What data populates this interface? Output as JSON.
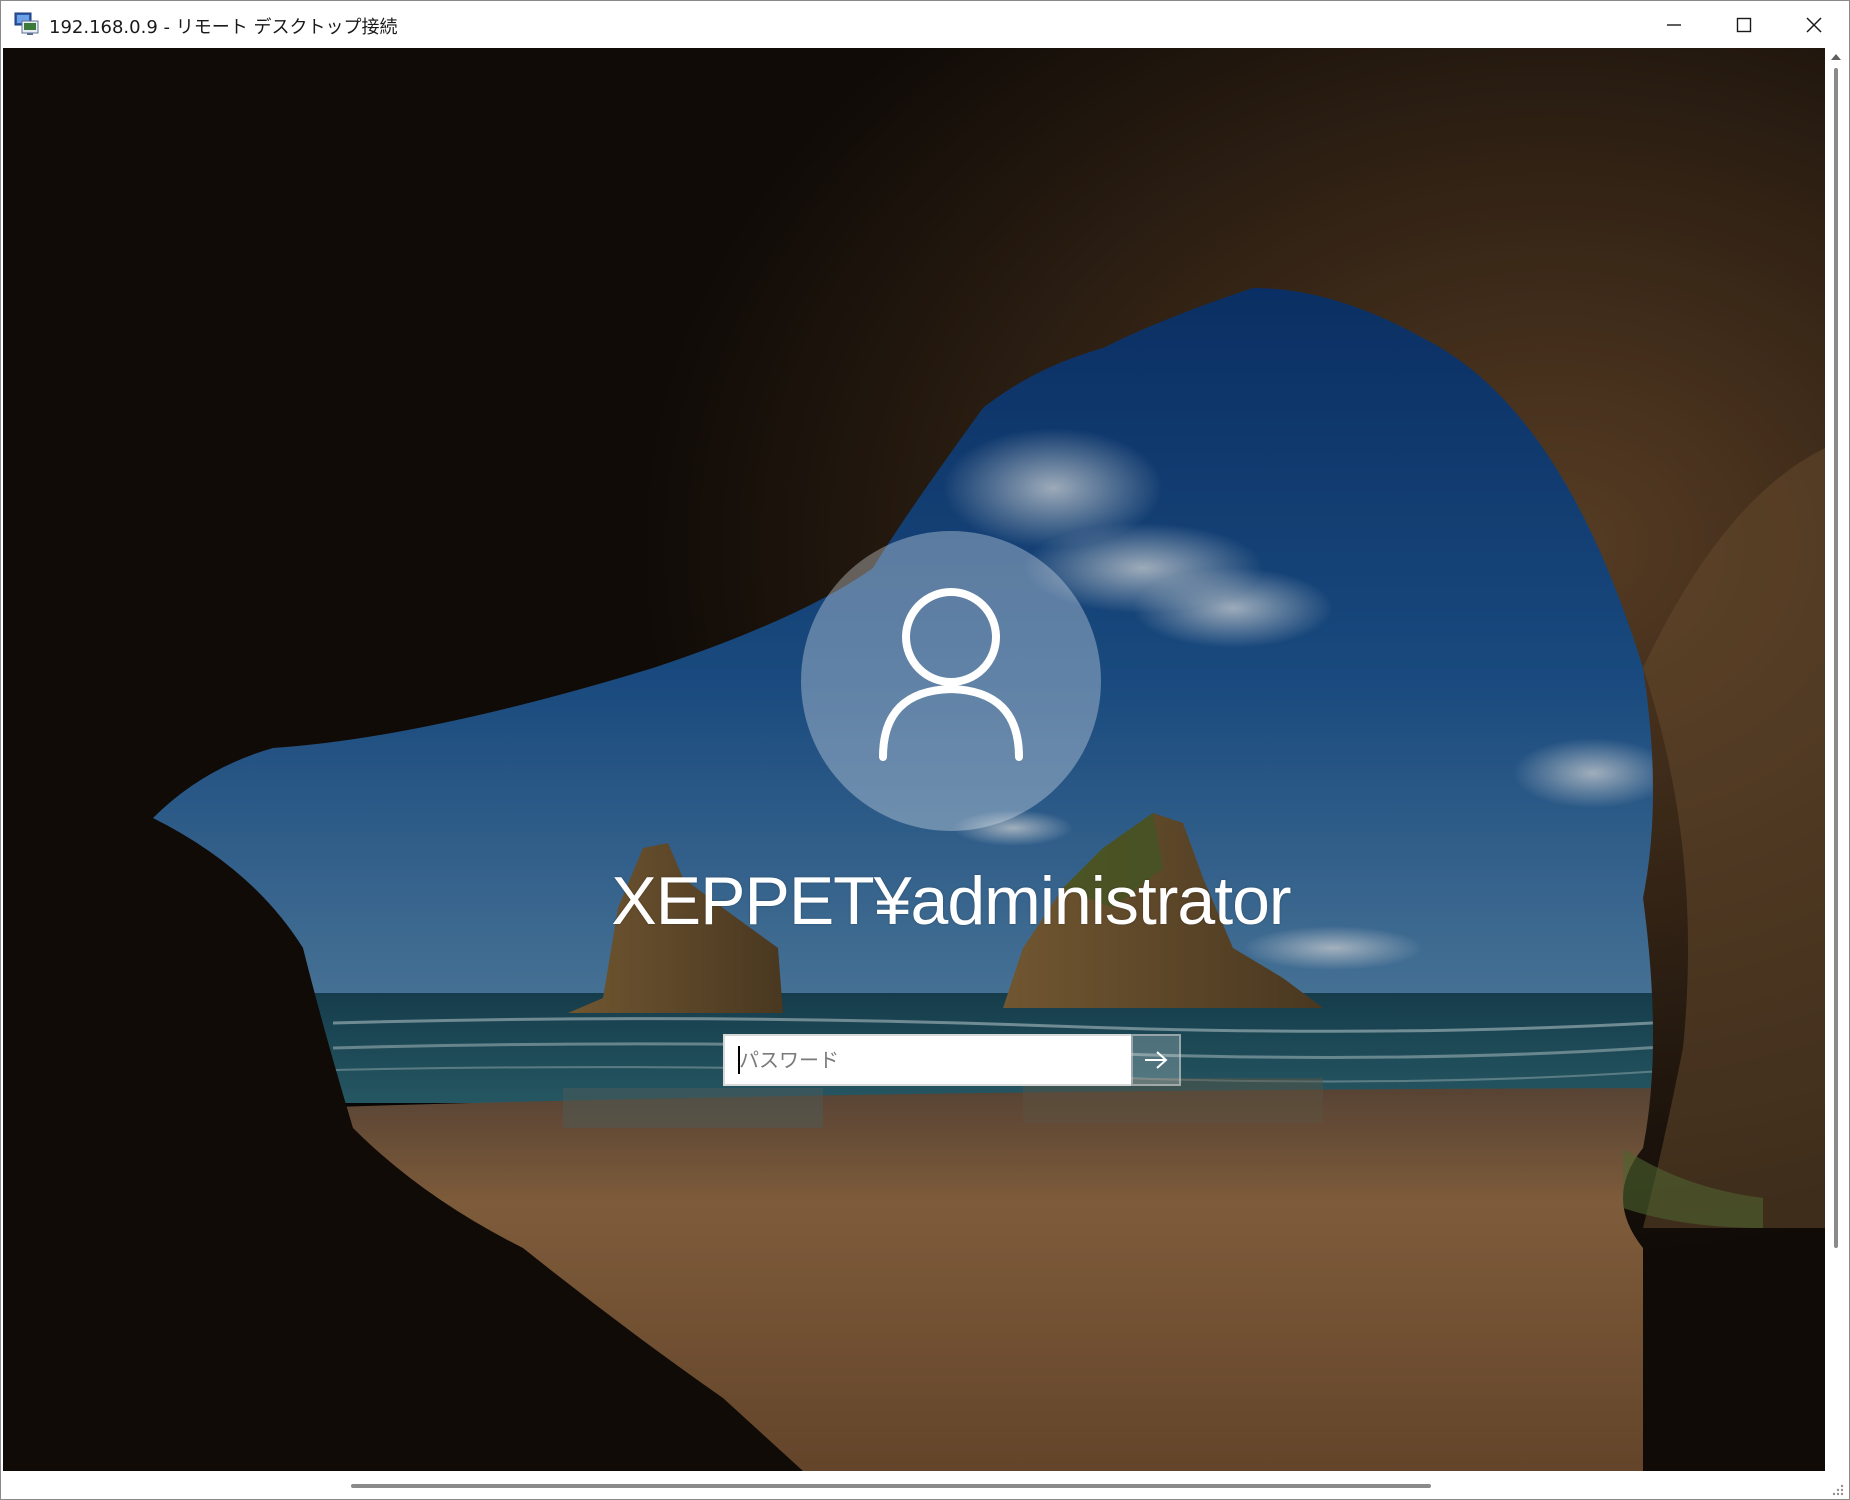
{
  "window": {
    "title": "192.168.0.9 - リモート デスクトップ接続",
    "icon": "remote-desktop-icon",
    "controls": {
      "minimize": "minimize-icon",
      "maximize": "maximize-icon",
      "close": "close-icon"
    }
  },
  "login": {
    "user_icon": "user-avatar-icon",
    "username": "XEPPET¥administrator",
    "password_placeholder": "パスワード",
    "password_value": "",
    "submit_icon": "arrow-right-icon"
  },
  "colors": {
    "sky": "#1f5a9a",
    "sea": "#1d5064",
    "sand": "#a8784a",
    "cave": "#140e09"
  }
}
